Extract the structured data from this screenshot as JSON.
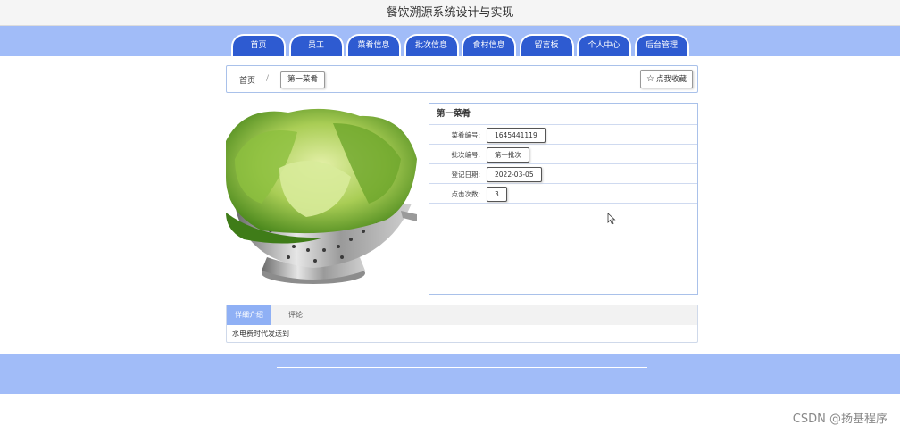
{
  "header": {
    "title": "餐饮溯源系统设计与实现"
  },
  "nav": {
    "items": [
      {
        "label": "首页"
      },
      {
        "label": "员工"
      },
      {
        "label": "菜肴信息"
      },
      {
        "label": "批次信息"
      },
      {
        "label": "食材信息"
      },
      {
        "label": "留言板"
      },
      {
        "label": "个人中心"
      },
      {
        "label": "后台管理"
      }
    ]
  },
  "breadcrumb": {
    "home": "首页",
    "separator": "/",
    "current": "第一菜肴",
    "favorite_label": "点我收藏"
  },
  "dish": {
    "name": "第一菜肴",
    "fields": [
      {
        "label": "菜肴编号:",
        "value": "1645441119"
      },
      {
        "label": "批次编号:",
        "value": "第一批次"
      },
      {
        "label": "登记日期:",
        "value": "2022-03-05"
      },
      {
        "label": "点击次数:",
        "value": "3"
      }
    ]
  },
  "tabs": {
    "items": [
      {
        "label": "详细介绍",
        "active": true
      },
      {
        "label": "评论",
        "active": false
      }
    ],
    "content": "水电费时代发送到"
  },
  "watermark": "CSDN @扬基程序",
  "colors": {
    "nav_band": "#a1bcf8",
    "nav_tab": "#2e5bd1",
    "active_tab": "#8fb0f5",
    "border": "#a9c1ea"
  }
}
